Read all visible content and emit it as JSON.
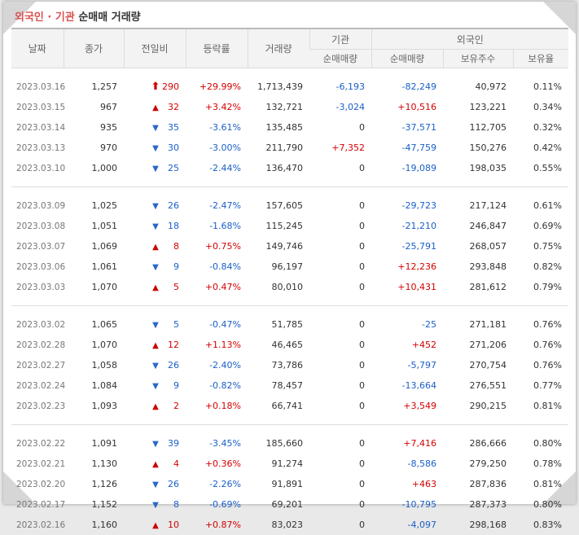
{
  "title": {
    "part1": "외국인 · 기관",
    "part2": " 순매매 거래량"
  },
  "headers": {
    "date": "날짜",
    "close": "종가",
    "change": "전일비",
    "rate": "등락률",
    "volume": "거래량",
    "institution": "기관",
    "foreigner": "외국인",
    "inst_net": "순매매량",
    "for_net": "순매매량",
    "for_holdings": "보유주수",
    "for_ratio": "보유율"
  },
  "groups": [
    [
      {
        "date": "2023.03.16",
        "close": "1,257",
        "dir": "upper",
        "change": "290",
        "rate": "+29.99%",
        "volume": "1,713,439",
        "inst": "-6,193",
        "foreign": "-82,249",
        "holdings": "40,972",
        "ratio": "0.11%"
      },
      {
        "date": "2023.03.15",
        "close": "967",
        "dir": "up",
        "change": "32",
        "rate": "+3.42%",
        "volume": "132,721",
        "inst": "-3,024",
        "foreign": "+10,516",
        "holdings": "123,221",
        "ratio": "0.34%"
      },
      {
        "date": "2023.03.14",
        "close": "935",
        "dir": "down",
        "change": "35",
        "rate": "-3.61%",
        "volume": "135,485",
        "inst": "0",
        "foreign": "-37,571",
        "holdings": "112,705",
        "ratio": "0.32%"
      },
      {
        "date": "2023.03.13",
        "close": "970",
        "dir": "down",
        "change": "30",
        "rate": "-3.00%",
        "volume": "211,790",
        "inst": "+7,352",
        "foreign": "-47,759",
        "holdings": "150,276",
        "ratio": "0.42%"
      },
      {
        "date": "2023.03.10",
        "close": "1,000",
        "dir": "down",
        "change": "25",
        "rate": "-2.44%",
        "volume": "136,470",
        "inst": "0",
        "foreign": "-19,089",
        "holdings": "198,035",
        "ratio": "0.55%"
      }
    ],
    [
      {
        "date": "2023.03.09",
        "close": "1,025",
        "dir": "down",
        "change": "26",
        "rate": "-2.47%",
        "volume": "157,605",
        "inst": "0",
        "foreign": "-29,723",
        "holdings": "217,124",
        "ratio": "0.61%"
      },
      {
        "date": "2023.03.08",
        "close": "1,051",
        "dir": "down",
        "change": "18",
        "rate": "-1.68%",
        "volume": "115,245",
        "inst": "0",
        "foreign": "-21,210",
        "holdings": "246,847",
        "ratio": "0.69%"
      },
      {
        "date": "2023.03.07",
        "close": "1,069",
        "dir": "up",
        "change": "8",
        "rate": "+0.75%",
        "volume": "149,746",
        "inst": "0",
        "foreign": "-25,791",
        "holdings": "268,057",
        "ratio": "0.75%"
      },
      {
        "date": "2023.03.06",
        "close": "1,061",
        "dir": "down",
        "change": "9",
        "rate": "-0.84%",
        "volume": "96,197",
        "inst": "0",
        "foreign": "+12,236",
        "holdings": "293,848",
        "ratio": "0.82%"
      },
      {
        "date": "2023.03.03",
        "close": "1,070",
        "dir": "up",
        "change": "5",
        "rate": "+0.47%",
        "volume": "80,010",
        "inst": "0",
        "foreign": "+10,431",
        "holdings": "281,612",
        "ratio": "0.79%"
      }
    ],
    [
      {
        "date": "2023.03.02",
        "close": "1,065",
        "dir": "down",
        "change": "5",
        "rate": "-0.47%",
        "volume": "51,785",
        "inst": "0",
        "foreign": "-25",
        "holdings": "271,181",
        "ratio": "0.76%"
      },
      {
        "date": "2023.02.28",
        "close": "1,070",
        "dir": "up",
        "change": "12",
        "rate": "+1.13%",
        "volume": "46,465",
        "inst": "0",
        "foreign": "+452",
        "holdings": "271,206",
        "ratio": "0.76%"
      },
      {
        "date": "2023.02.27",
        "close": "1,058",
        "dir": "down",
        "change": "26",
        "rate": "-2.40%",
        "volume": "73,786",
        "inst": "0",
        "foreign": "-5,797",
        "holdings": "270,754",
        "ratio": "0.76%"
      },
      {
        "date": "2023.02.24",
        "close": "1,084",
        "dir": "down",
        "change": "9",
        "rate": "-0.82%",
        "volume": "78,457",
        "inst": "0",
        "foreign": "-13,664",
        "holdings": "276,551",
        "ratio": "0.77%"
      },
      {
        "date": "2023.02.23",
        "close": "1,093",
        "dir": "up",
        "change": "2",
        "rate": "+0.18%",
        "volume": "66,741",
        "inst": "0",
        "foreign": "+3,549",
        "holdings": "290,215",
        "ratio": "0.81%"
      }
    ],
    [
      {
        "date": "2023.02.22",
        "close": "1,091",
        "dir": "down",
        "change": "39",
        "rate": "-3.45%",
        "volume": "185,660",
        "inst": "0",
        "foreign": "+7,416",
        "holdings": "286,666",
        "ratio": "0.80%"
      },
      {
        "date": "2023.02.21",
        "close": "1,130",
        "dir": "up",
        "change": "4",
        "rate": "+0.36%",
        "volume": "91,274",
        "inst": "0",
        "foreign": "-8,586",
        "holdings": "279,250",
        "ratio": "0.78%"
      },
      {
        "date": "2023.02.20",
        "close": "1,126",
        "dir": "down",
        "change": "26",
        "rate": "-2.26%",
        "volume": "91,891",
        "inst": "0",
        "foreign": "+463",
        "holdings": "287,836",
        "ratio": "0.81%"
      },
      {
        "date": "2023.02.17",
        "close": "1,152",
        "dir": "down",
        "change": "8",
        "rate": "-0.69%",
        "volume": "69,201",
        "inst": "0",
        "foreign": "-10,795",
        "holdings": "287,373",
        "ratio": "0.80%"
      },
      {
        "date": "2023.02.16",
        "close": "1,160",
        "dir": "up",
        "change": "10",
        "rate": "+0.87%",
        "volume": "83,023",
        "inst": "0",
        "foreign": "-4,097",
        "holdings": "298,168",
        "ratio": "0.83%"
      }
    ]
  ],
  "icons": {
    "upper": "limit-up-arrow-icon",
    "up": "triangle-up-icon",
    "down": "triangle-down-icon"
  },
  "colors": {
    "up": "#d40000",
    "down": "#1a5fc8",
    "title_accent": "#d9534f"
  }
}
